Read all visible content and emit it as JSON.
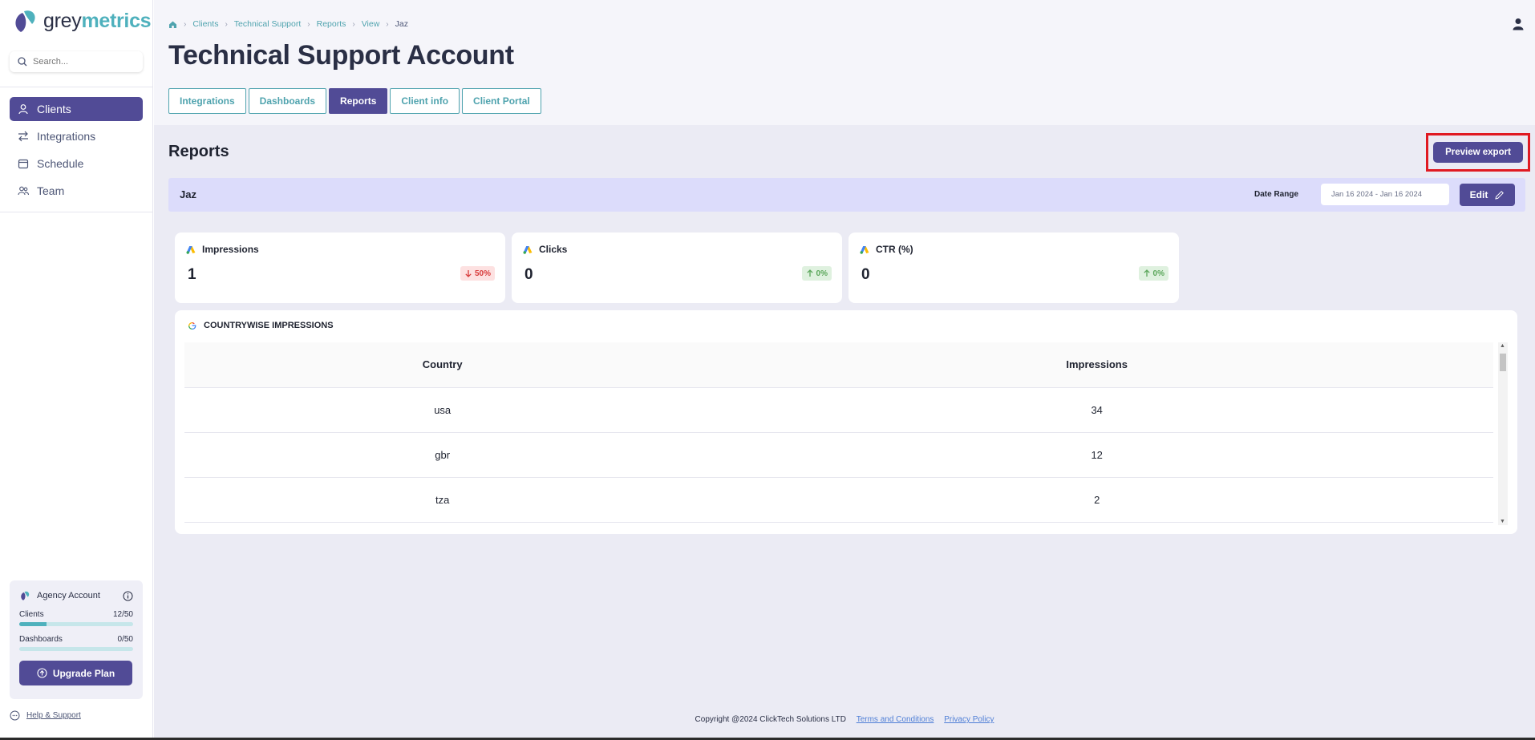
{
  "brand": {
    "name_part1": "grey",
    "name_part2": "metrics"
  },
  "search": {
    "placeholder": "Search..."
  },
  "nav": {
    "items": [
      {
        "label": "Clients",
        "icon": "user-icon"
      },
      {
        "label": "Integrations",
        "icon": "arrows-icon"
      },
      {
        "label": "Schedule",
        "icon": "calendar-icon"
      },
      {
        "label": "Team",
        "icon": "team-icon"
      }
    ]
  },
  "agency": {
    "title": "Agency Account",
    "clients_label": "Clients",
    "clients_value": "12/50",
    "clients_fraction": 0.24,
    "dashboards_label": "Dashboards",
    "dashboards_value": "0/50",
    "dashboards_fraction": 0,
    "upgrade_label": "Upgrade Plan"
  },
  "help": {
    "label": "Help & Support"
  },
  "breadcrumb": {
    "items": [
      "Clients",
      "Technical Support",
      "Reports",
      "View"
    ],
    "current": "Jaz"
  },
  "page": {
    "title": "Technical Support Account"
  },
  "tabs": [
    "Integrations",
    "Dashboards",
    "Reports",
    "Client info",
    "Client Portal"
  ],
  "reports": {
    "section_title": "Reports",
    "preview_label": "Preview export",
    "report_name": "Jaz",
    "date_range_label": "Date Range",
    "date_range_value": "Jan 16 2024 - Jan 16 2024",
    "edit_label": "Edit"
  },
  "kpis": [
    {
      "label": "Impressions",
      "value": "1",
      "change": "50%",
      "trend": "down"
    },
    {
      "label": "Clicks",
      "value": "0",
      "change": "0%",
      "trend": "up"
    },
    {
      "label": "CTR (%)",
      "value": "0",
      "change": "0%",
      "trend": "up"
    }
  ],
  "table": {
    "title": "COUNTRYWISE IMPRESSIONS",
    "headers": [
      "Country",
      "Impressions"
    ],
    "rows": [
      [
        "usa",
        "34"
      ],
      [
        "gbr",
        "12"
      ],
      [
        "tza",
        "2"
      ]
    ]
  },
  "footer": {
    "copyright": "Copyright @2024 ClickTech Solutions LTD",
    "terms": "Terms and Conditions",
    "privacy": "Privacy Policy"
  },
  "colors": {
    "accent": "#514b96",
    "teal": "#4fb1bd",
    "highlight": "#e01a22"
  }
}
